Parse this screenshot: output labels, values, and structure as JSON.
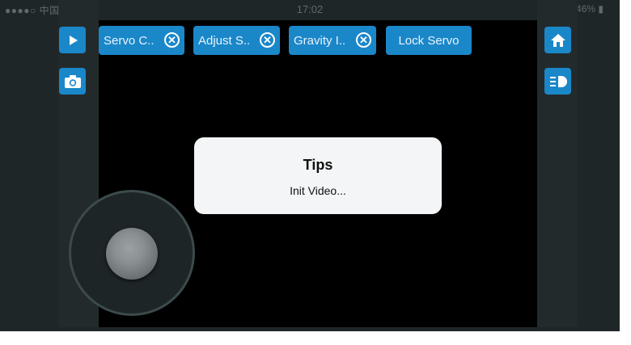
{
  "status_bar": {
    "carrier": "●●●●○ 中国联通 ᯤ",
    "time": "17:02",
    "battery": "✱ ➚ ● 46% ▮"
  },
  "toolbar": {
    "tabs": [
      {
        "label": "Servo C..",
        "close_icon": "close-circle-icon"
      },
      {
        "label": "Adjust S..",
        "close_icon": "close-circle-icon"
      },
      {
        "label": "Gravity I..",
        "close_icon": "close-circle-icon"
      },
      {
        "label": "Lock Servo"
      }
    ],
    "close_glyph": "✕"
  },
  "icons": {
    "play": "play-icon",
    "camera": "camera-icon",
    "home": "home-icon",
    "light": "headlight-icon",
    "joystick": "joystick-knob"
  },
  "dialog": {
    "title": "Tips",
    "message": "Init Video..."
  },
  "colors": {
    "accent": "#1a87c9",
    "background": "#1f2627",
    "video": "#000000",
    "dialog": "#f3f5f6"
  }
}
